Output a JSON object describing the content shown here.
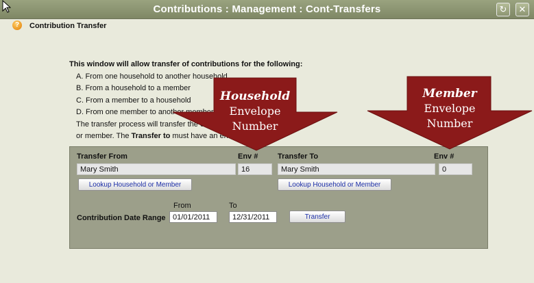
{
  "window": {
    "title": "Contributions : Management : Cont-Transfers",
    "refresh_icon": "refresh-icon",
    "close_icon": "close-icon"
  },
  "header": {
    "icon": "question-icon",
    "label": "Contribution Transfer"
  },
  "intro": {
    "lead": "This window will allow transfer of contributions for the following:",
    "items": [
      "A. From one household to another household",
      "B. From a household to a member",
      "C. From a member to a household",
      "D. From one member to another member"
    ],
    "note_line1": "The transfer process will transfer the contributions to a household",
    "note_line2_pre": "or member. The ",
    "note_line2_bold": "Transfer to",
    "note_line2_post": " must have an envelope number."
  },
  "transfer_from": {
    "label": "Transfer From",
    "env_label": "Env #",
    "name": "Mary Smith",
    "env": "16",
    "lookup_label": "Lookup Household or Member"
  },
  "transfer_to": {
    "label": "Transfer To",
    "env_label": "Env #",
    "name": "Mary Smith",
    "env": "0",
    "lookup_label": "Lookup Household or Member"
  },
  "date_range": {
    "label": "Contribution Date Range",
    "from_label": "From",
    "to_label": "To",
    "from_value": "01/01/2011",
    "to_value": "12/31/2011"
  },
  "transfer_button": "Transfer",
  "callouts": {
    "household": {
      "line1": "Household",
      "line2": "Envelope",
      "line3": "Number"
    },
    "member": {
      "line1": "Member",
      "line2": "Envelope",
      "line3": "Number"
    },
    "color": "#8b1a1a"
  }
}
